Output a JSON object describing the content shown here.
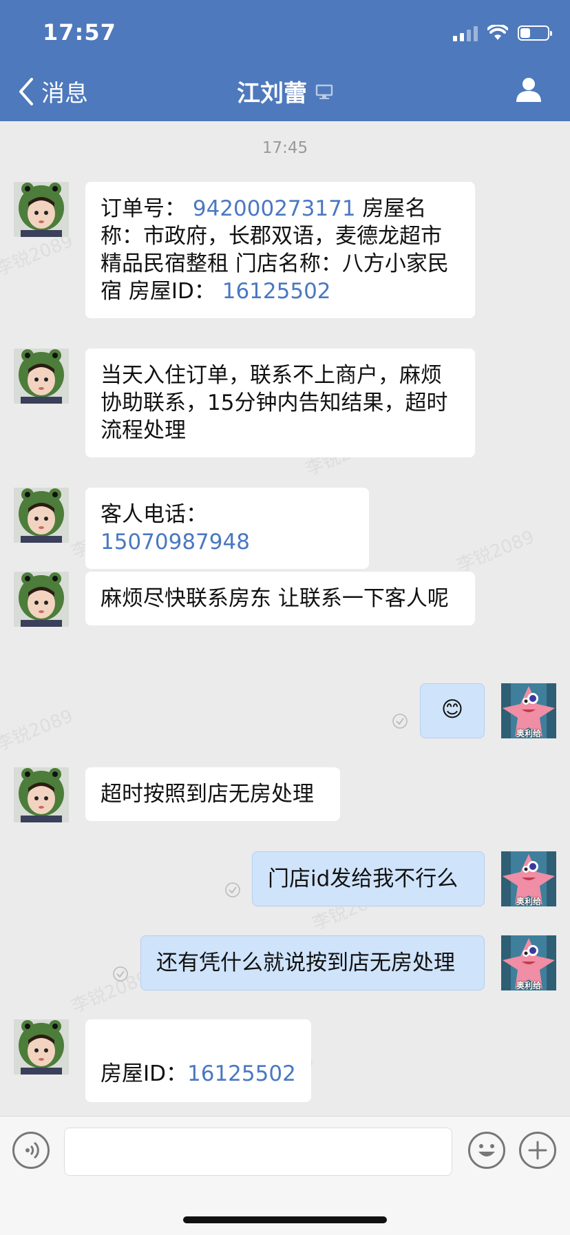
{
  "status_bar": {
    "time": "17:57"
  },
  "nav": {
    "back_label": "消息",
    "title": "江刘蕾"
  },
  "chat": {
    "timestamp": "17:45",
    "messages": [
      {
        "from": "other",
        "segments": [
          "订单号：",
          "942000273171",
          "房屋名称：市政府，长郡双语，麦德龙超市精品民宿整租 门店名称：八方小家民宿 房屋ID：",
          "16125502"
        ]
      },
      {
        "from": "other",
        "text": "当天入住订单，联系不上商户，麻烦协助联系，15分钟内告知结果，超时流程处理"
      },
      {
        "from": "other",
        "segments": [
          "客人电话：",
          "15070987948"
        ]
      },
      {
        "from": "other",
        "text": "麻烦尽快联系房东 让联系一下客人呢"
      },
      {
        "from": "me",
        "emoji": "😊"
      },
      {
        "from": "other",
        "text": "超时按照到店无房处理"
      },
      {
        "from": "me",
        "text": "门店id发给我不行么"
      },
      {
        "from": "me",
        "text": "还有凭什么就说按到店无房处理"
      },
      {
        "from": "other",
        "segments": [
          "房屋ID：",
          "16125502"
        ]
      }
    ]
  },
  "avatars": {
    "me_caption": "奥利给"
  },
  "watermark": "李锐2089",
  "colors": {
    "header": "#4e79bc",
    "link": "#4a78c1",
    "bubble_out": "#cfe3fb"
  }
}
